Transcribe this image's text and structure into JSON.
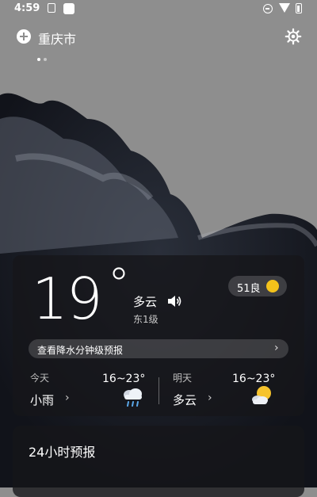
{
  "status_bar": {
    "time": "4:59",
    "icons": [
      "sim-icon",
      "notification-icon",
      "do-not-disturb-icon",
      "wifi-icon",
      "battery-icon"
    ]
  },
  "header": {
    "add_icon": "add-city-icon",
    "city": "重庆市",
    "settings_icon": "gear-icon",
    "page_count": 2,
    "active_page": 1
  },
  "current": {
    "temperature": "19",
    "degree_symbol": "°",
    "condition": "多云",
    "wind": "东1级",
    "aqi": "51良",
    "speaker_icon": "speaker-icon",
    "minute_forecast_label": "查看降水分钟级预报",
    "minute_forecast_arrow": "›"
  },
  "forecast": {
    "today": {
      "label": "今天",
      "condition": "小雨",
      "range": "16~23°",
      "arrow": "›",
      "icon": "rain-cloud-icon"
    },
    "tomorrow": {
      "label": "明天",
      "condition": "多云",
      "range": "16~23°",
      "arrow": "›",
      "icon": "sun-cloud-icon"
    }
  },
  "hourly": {
    "title": "24小时预报"
  },
  "colors": {
    "sky": "#8e8e8e",
    "card": "#16161a",
    "accent_yellow": "#f3c21b"
  }
}
